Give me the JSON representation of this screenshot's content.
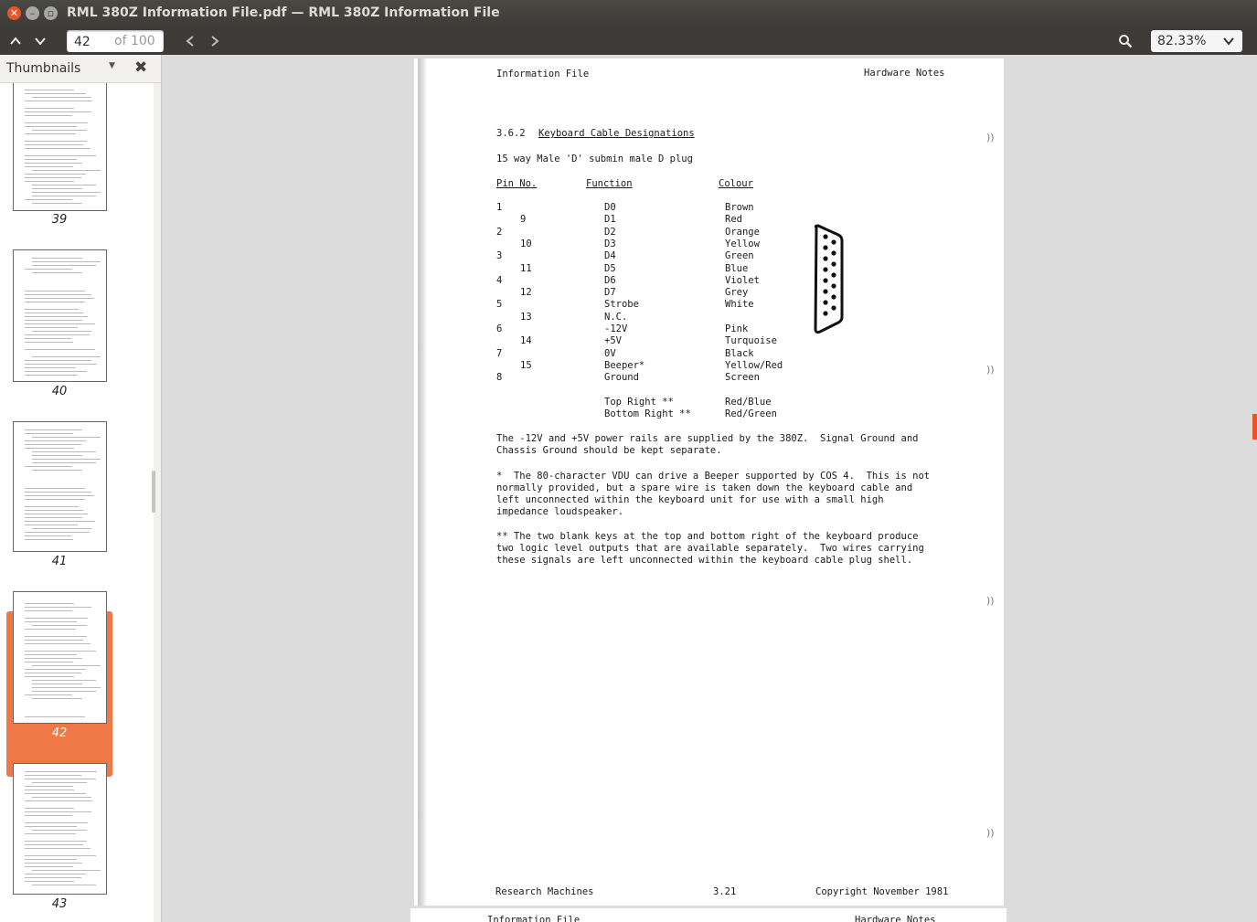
{
  "window": {
    "title": "RML 380Z Information File.pdf — RML 380Z Information File"
  },
  "toolbar": {
    "page_number": "42",
    "page_total": "of 100",
    "zoom": "82.33%"
  },
  "sidebar": {
    "title": "Thumbnails",
    "thumbnails": [
      {
        "label": "39"
      },
      {
        "label": "40"
      },
      {
        "label": "41"
      },
      {
        "label": "42",
        "selected": true
      },
      {
        "label": "43"
      }
    ]
  },
  "document": {
    "header_left": "Information File",
    "header_right": "Hardware Notes",
    "section_number": "3.6.2",
    "section_title": "Keyboard Cable Designations",
    "plug": "15 way Male 'D' submin male D plug",
    "col_pin": "Pin No.",
    "col_function": "Function",
    "col_colour": "Colour",
    "rows": [
      {
        "pin": "1",
        "function": "D0",
        "colour": "Brown"
      },
      {
        "pin": "9",
        "function": "D1",
        "colour": "Red"
      },
      {
        "pin": "2",
        "function": "D2",
        "colour": "Orange"
      },
      {
        "pin": "10",
        "function": "D3",
        "colour": "Yellow"
      },
      {
        "pin": "3",
        "function": "D4",
        "colour": "Green"
      },
      {
        "pin": "11",
        "function": "D5",
        "colour": "Blue"
      },
      {
        "pin": "4",
        "function": "D6",
        "colour": "Violet"
      },
      {
        "pin": "12",
        "function": "D7",
        "colour": "Grey"
      },
      {
        "pin": "5",
        "function": "Strobe",
        "colour": "White"
      },
      {
        "pin": "13",
        "function": "N.C.",
        "colour": ""
      },
      {
        "pin": "6",
        "function": "-12V",
        "colour": "Pink"
      },
      {
        "pin": "14",
        "function": "+5V",
        "colour": "Turquoise"
      },
      {
        "pin": "7",
        "function": "0V",
        "colour": "Black"
      },
      {
        "pin": "15",
        "function": "Beeper*",
        "colour": "Yellow/Red"
      },
      {
        "pin": "8",
        "function": "Ground",
        "colour": "Screen"
      }
    ],
    "extra_rows": [
      {
        "function": "Top Right **",
        "colour": "Red/Blue"
      },
      {
        "function": "Bottom Right **",
        "colour": "Red/Green"
      }
    ],
    "para1": [
      "The -12V and +5V power rails are supplied by the 380Z.  Signal Ground and",
      "Chassis Ground should be kept separate."
    ],
    "para2": [
      "*  The 80-character VDU can drive a Beeper supported by COS 4.  This is not",
      "normally provided, but a spare wire is taken down the keyboard cable and",
      "left unconnected within the keyboard unit for use with a small high",
      "impedance loudspeaker."
    ],
    "para3": [
      "** The two blank keys at the top and bottom right of the keyboard produce",
      "two logic level outputs that are available separately.  Two wires carrying",
      "these signals are left unconnected within the keyboard cable plug shell."
    ],
    "footer_left": "Research Machines",
    "footer_center": "3.21",
    "footer_right": "Copyright November 1981",
    "next_header_left": "Information File",
    "next_header_right": "Hardware Notes"
  }
}
